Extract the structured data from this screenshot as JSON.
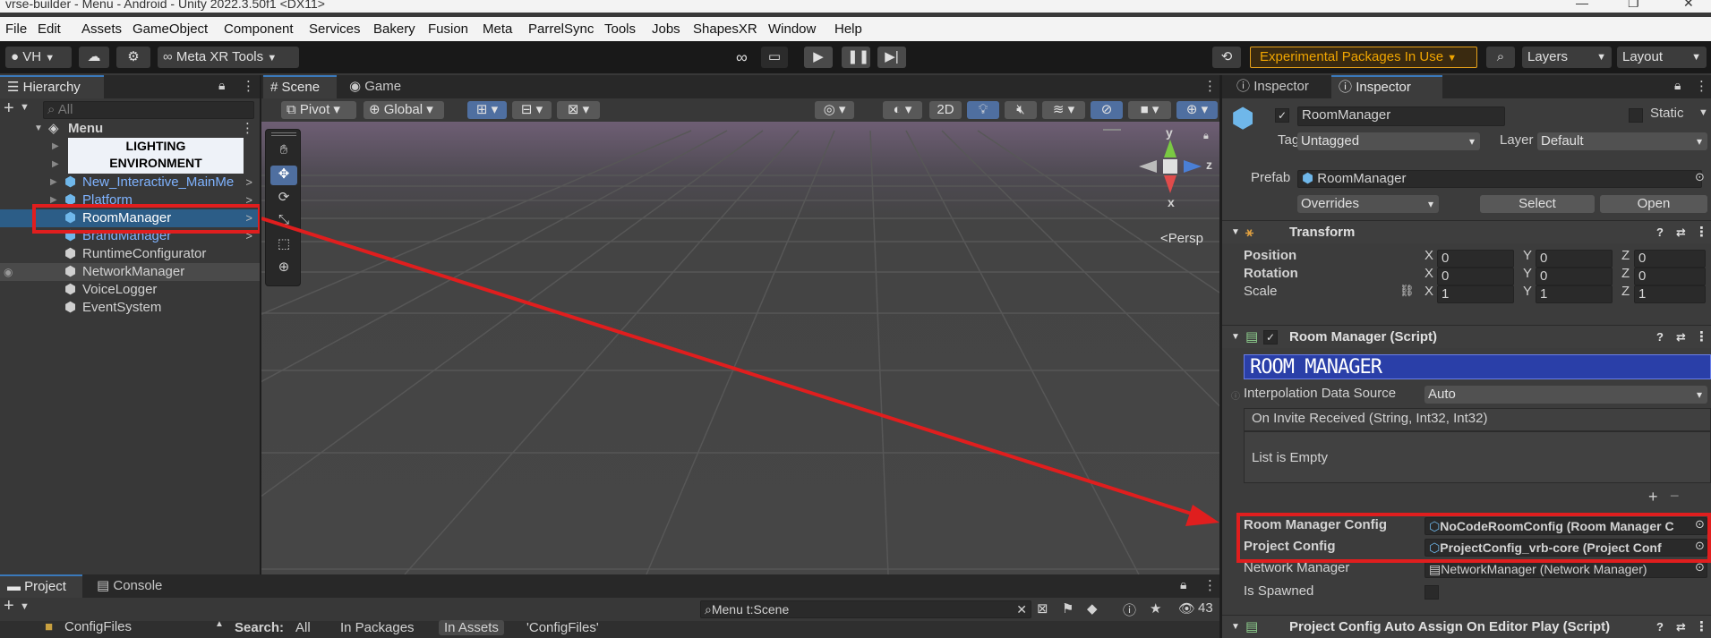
{
  "window": {
    "title": "vrse-builder - Menu - Android - Unity 2022.3.50f1 <DX11>",
    "controls": [
      "—",
      "❐",
      "✕"
    ]
  },
  "menubar": [
    "File",
    "Edit",
    "Assets",
    "GameObject",
    "Component",
    "Services",
    "Bakery",
    "Fusion",
    "Meta",
    "ParrelSync",
    "Tools",
    "Jobs",
    "ShapesXR",
    "Window",
    "Help"
  ],
  "toolbar": {
    "account": "VH",
    "meta_tools": "Meta XR Tools",
    "experimental": "Experimental Packages In Use",
    "layers": "Layers",
    "layout": "Layout"
  },
  "hierarchy": {
    "tab": "Hierarchy",
    "search_placeholder": "All",
    "root": "Menu",
    "lighting_label": "LIGHTING\nENVIRONMENT",
    "items": [
      {
        "label": "New_Interactive_MainMe",
        "prefab": true,
        "color": "#7fb3ff"
      },
      {
        "label": "Platform",
        "prefab": true,
        "color": "#7fb3ff"
      },
      {
        "label": "RoomManager",
        "prefab": true,
        "selected": true
      },
      {
        "label": "BrandManager",
        "prefab": true,
        "color": "#7fb3ff"
      },
      {
        "label": "RuntimeConfigurator",
        "prefab": false
      },
      {
        "label": "NetworkManager",
        "prefab": false
      },
      {
        "label": "VoiceLogger",
        "prefab": false
      },
      {
        "label": "EventSystem",
        "prefab": false
      }
    ]
  },
  "scene": {
    "tabs": [
      "Scene",
      "Game"
    ],
    "pivot": "Pivot",
    "global": "Global",
    "mode_2d": "2D",
    "persp": "Persp",
    "gizmo": {
      "y": "y",
      "x": "x",
      "z": "z"
    }
  },
  "inspector": {
    "tabs": [
      "Inspector",
      "Inspector"
    ],
    "object_name": "RoomManager",
    "static_label": "Static",
    "tag_label": "Tag",
    "tag_value": "Untagged",
    "layer_label": "Layer",
    "layer_value": "Default",
    "prefab_label": "Prefab",
    "prefab_value": "RoomManager",
    "overrides": "Overrides",
    "select": "Select",
    "open": "Open",
    "transform": {
      "title": "Transform",
      "rows": [
        {
          "label": "Position",
          "x": "0",
          "y": "0",
          "z": "0"
        },
        {
          "label": "Rotation",
          "x": "0",
          "y": "0",
          "z": "0"
        },
        {
          "label": "Scale",
          "x": "1",
          "y": "1",
          "z": "1"
        }
      ]
    },
    "script": {
      "title": "Room Manager (Script)",
      "banner": "ROOM MANAGER",
      "interp_label": "Interpolation Data Source",
      "interp_value": "Auto",
      "event_label": "On Invite Received (String, Int32, Int32)",
      "list_empty": "List is Empty",
      "room_config_label": "Room Manager Config",
      "room_config_value": "NoCodeRoomConfig (Room Manager C",
      "project_config_label": "Project Config",
      "project_config_value": "ProjectConfig_vrb-core (Project Conf",
      "network_label": "Network Manager",
      "network_value": "NetworkManager (Network Manager)",
      "spawned_label": "Is Spawned"
    },
    "next_component": "Project Config Auto Assign On Editor Play (Script)"
  },
  "project": {
    "tabs": [
      "Project",
      "Console"
    ],
    "search_value": "Menu t:Scene",
    "count": "43",
    "folder": "ConfigFiles",
    "search_label": "Search:",
    "filters": [
      "All",
      "In Packages",
      "In Assets",
      "'ConfigFiles'"
    ]
  },
  "colors": {
    "accent": "#3a79bb",
    "highlight": "#e01e1e",
    "banner": "#2a3fa8",
    "warning": "#f0a500"
  }
}
